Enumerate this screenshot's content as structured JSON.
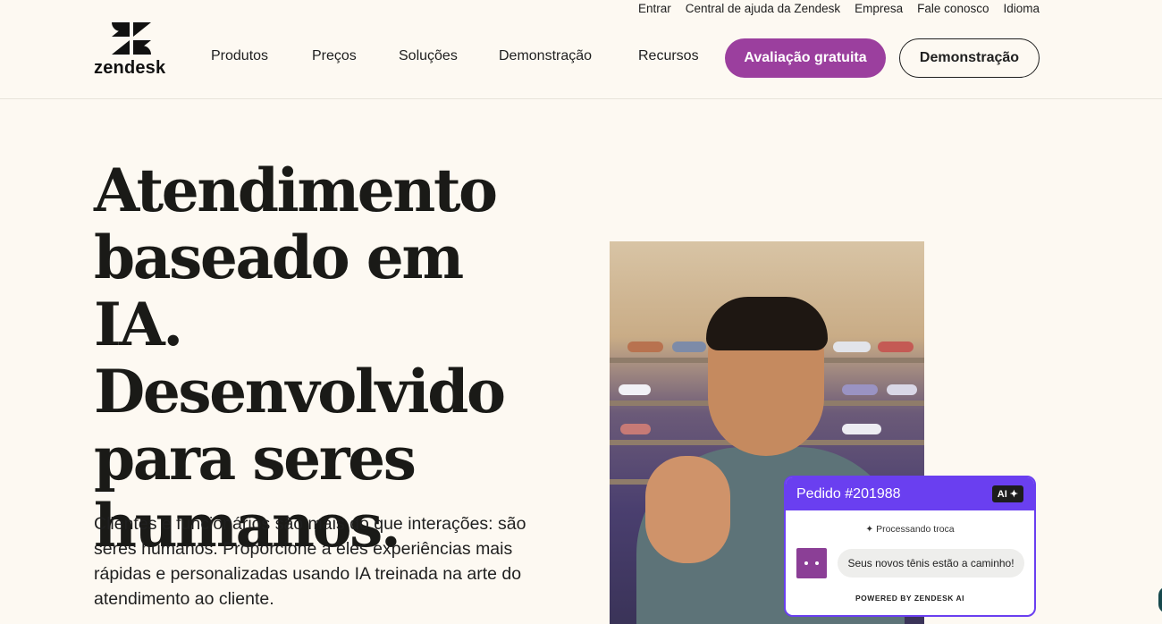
{
  "utility_nav": {
    "login": "Entrar",
    "help_center": "Central de ajuda da Zendesk",
    "company": "Empresa",
    "contact": "Fale conosco",
    "language": "Idioma"
  },
  "brand": {
    "name": "zendesk"
  },
  "main_nav": {
    "products": "Produtos",
    "pricing": "Preços",
    "solutions": "Soluções",
    "demo": "Demonstração",
    "resources": "Recursos"
  },
  "cta": {
    "trial": "Avaliação gratuita",
    "demo": "Demonstração"
  },
  "hero": {
    "headline": "Atendimento baseado em IA. Desenvolvido para seres humanos.",
    "subheadline": "Clientes e funcionários são mais do que interações: são seres humanos. Proporcione a eles experiências mais rápidas e personalizadas usando IA treinada na arte do atendimento ao cliente."
  },
  "chat_card": {
    "order_title": "Pedido #201988",
    "ai_badge": "AI",
    "status": "Processando troca",
    "message": "Seus novos tênis estão a caminho!",
    "powered_by": "POWERED BY ZENDESK AI"
  },
  "colors": {
    "background": "#fdf9f2",
    "trial_button": "#9b3f9e",
    "chat_accent": "#6a3ff0",
    "avatar": "#8b3f96"
  },
  "icons": [
    "zendesk-logo-icon",
    "sparkle-icon",
    "bot-avatar-icon"
  ]
}
